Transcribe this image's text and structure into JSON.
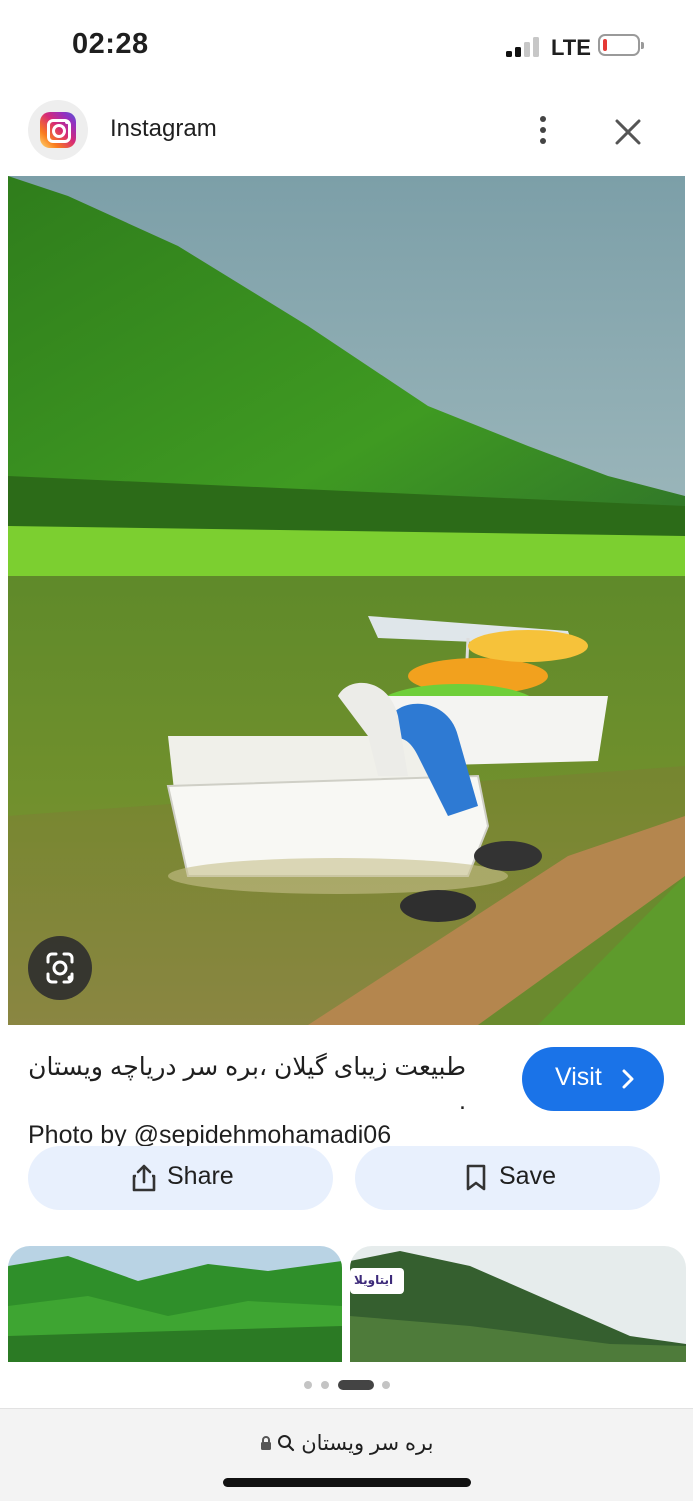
{
  "status_bar": {
    "time": "02:28",
    "network": "LTE",
    "battery_level": 0.12
  },
  "header": {
    "app_name": "Instagram",
    "icons": {
      "app": "instagram-icon",
      "more": "more-vert-icon",
      "close": "close-icon"
    }
  },
  "result": {
    "caption_fa": "طبیعت زیبای گیلان ،بره سر دریاچه ویستان .",
    "caption_credit": "Photo by @sepidehmohamadi06",
    "visit_label": "Visit",
    "lens_icon": "google-lens-icon"
  },
  "actions": {
    "share_label": "Share",
    "save_label": "Save"
  },
  "related": {
    "thumb_2_logo_text": "ایتاویلا"
  },
  "carousel": {
    "count": 4,
    "active_index": 2
  },
  "address_bar": {
    "query": "بره سر ویستان"
  },
  "colors": {
    "accent": "#1a73e8",
    "pill_bg": "#e8f0fd",
    "battery_low": "#e53935"
  }
}
